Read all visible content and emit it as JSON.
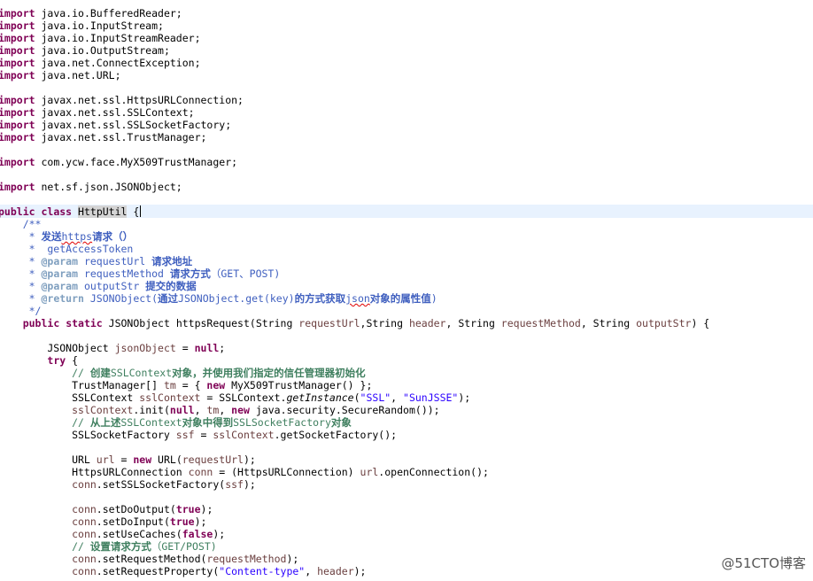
{
  "editor": {
    "imports": [
      "import java.io.BufferedReader;",
      "import java.io.InputStream;",
      "import java.io.InputStreamReader;",
      "import java.io.OutputStream;",
      "import java.net.ConnectException;",
      "import java.net.URL;",
      "import javax.net.ssl.HttpsURLConnection;",
      "import javax.net.ssl.SSLContext;",
      "import javax.net.ssl.SSLSocketFactory;",
      "import javax.net.ssl.TrustManager;",
      "import com.ycw.face.MyX509TrustManager;",
      "import net.sf.json.JSONObject;"
    ],
    "class_decl": "public class HttpUtil {",
    "javadoc": [
      "/**",
      " * 发送https请求（）",
      " *  getAccessToken",
      " * @param requestUrl 请求地址",
      " * @param requestMethod 请求方式（GET、POST)",
      " * @param outputStr 提交的数据",
      " * @return JSONObject(通过JSONObject.get(key)的方式获取json对象的属性值)",
      " */"
    ],
    "method_decl": "public static JSONObject httpsRequest(String requestUrl,String header, String requestMethod, String outputStr) {",
    "body": [
      "JSONObject jsonObject = null;",
      "try {",
      "// 创建SSLContext对象，并使用我们指定的信任管理器初始化",
      "TrustManager[] tm = { new MyX509TrustManager() };",
      "SSLContext sslContext = SSLContext.getInstance(\"SSL\", \"SunJSSE\");",
      "sslContext.init(null, tm, new java.security.SecureRandom());",
      "// 从上述SSLContext对象中得到SSLSocketFactory对象",
      "SSLSocketFactory ssf = sslContext.getSocketFactory();",
      "URL url = new URL(requestUrl);",
      "HttpsURLConnection conn = (HttpsURLConnection) url.openConnection();",
      "conn.setSSLSocketFactory(ssf);",
      "conn.setDoOutput(true);",
      "conn.setDoInput(true);",
      "conn.setUseCaches(false);",
      "// 设置请求方式（GET/POST)",
      "conn.setRequestMethod(requestMethod);",
      "conn.setRequestProperty(\"Content-type\", header);"
    ]
  },
  "watermark": "@51CTO博客",
  "colors": {
    "keyword": "#7f0055",
    "javadoc": "#3f5fbf",
    "javadoc_tag": "#7f9fbf",
    "comment": "#3f7f5f",
    "string": "#2a00ff",
    "local_variable": "#6a3e3e",
    "current_line": "#e8f2fe"
  }
}
